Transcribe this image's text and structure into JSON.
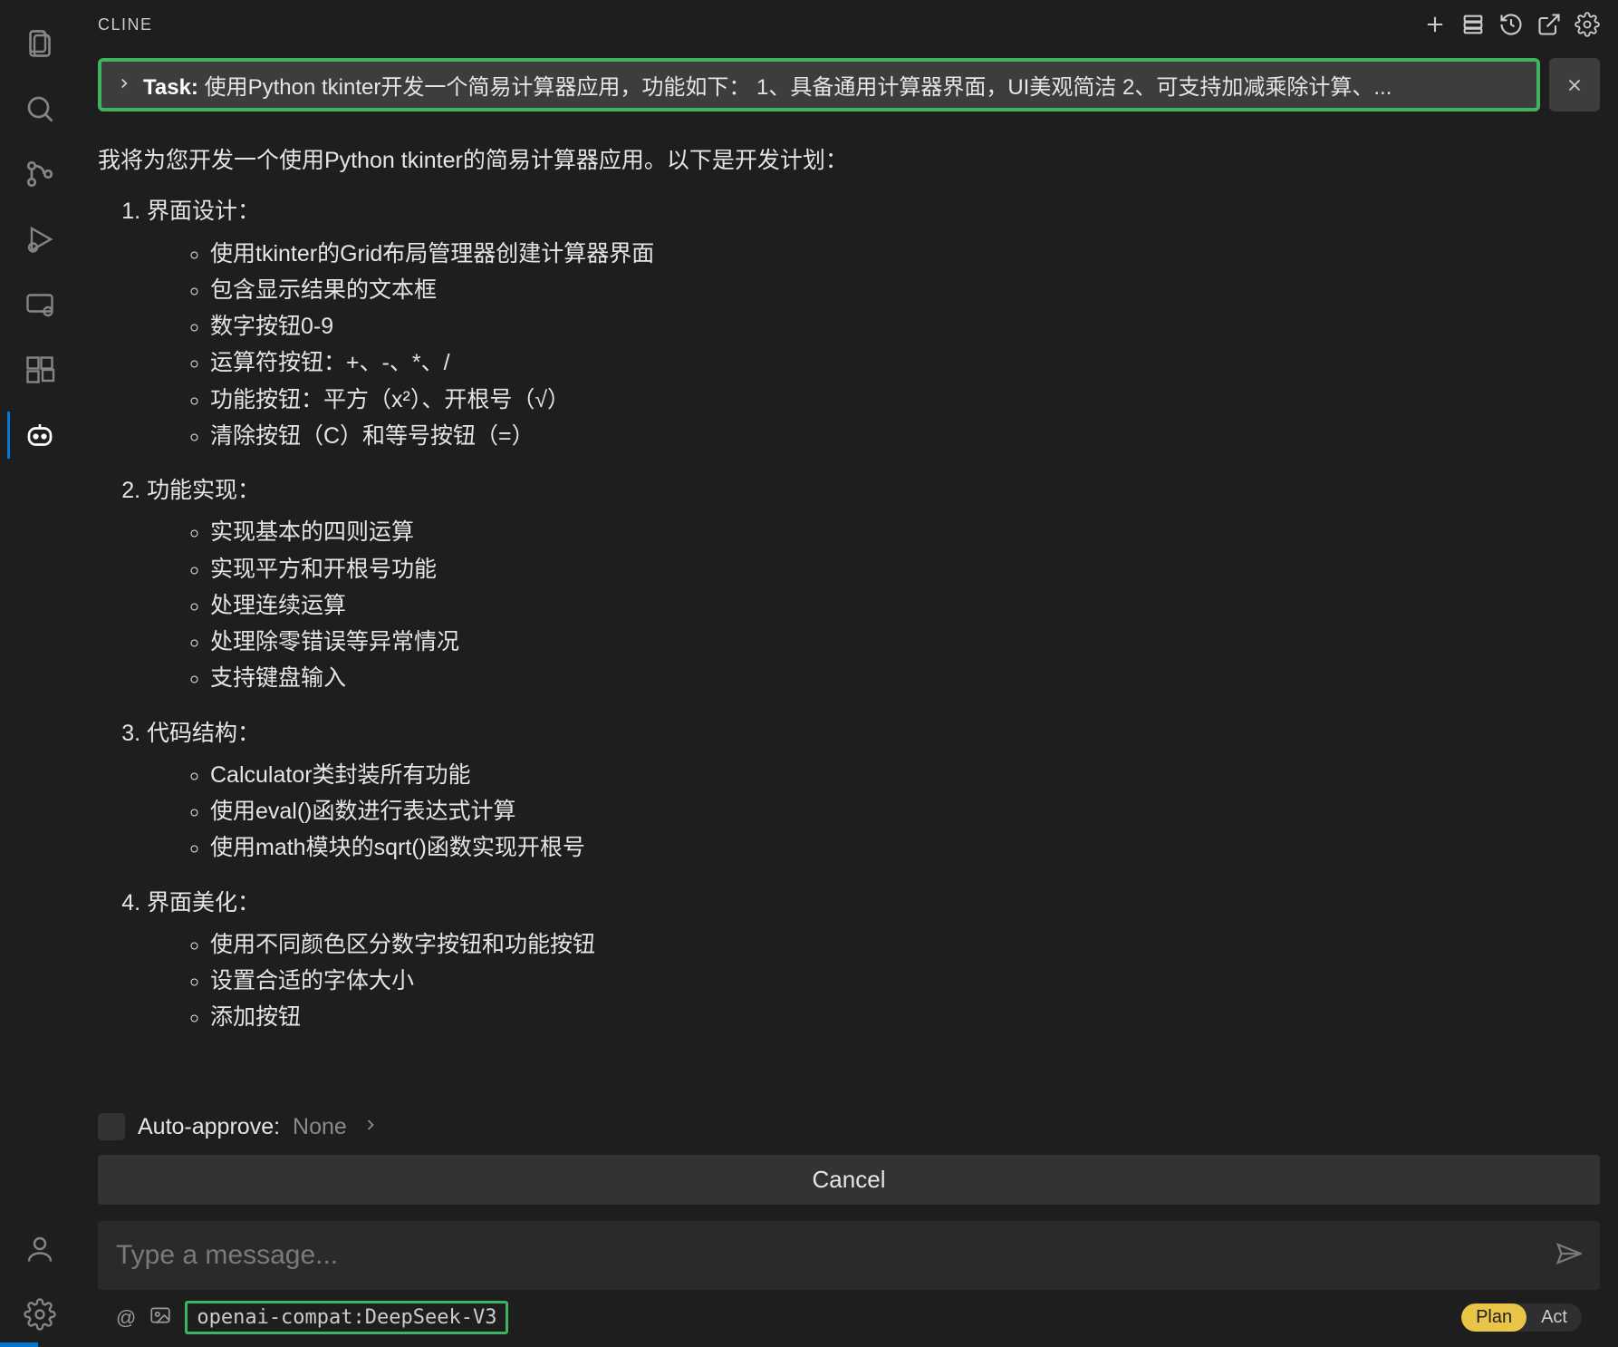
{
  "header": {
    "title": "CLINE"
  },
  "task": {
    "label": "Task:",
    "text": "使用Python tkinter开发一个简易计算器应用，功能如下： 1、具备通用计算器界面，UI美观简洁 2、可支持加减乘除计算、..."
  },
  "message": {
    "intro": "我将为您开发一个使用Python tkinter的简易计算器应用。以下是开发计划：",
    "sections": [
      {
        "title": "界面设计：",
        "items": [
          "使用tkinter的Grid布局管理器创建计算器界面",
          "包含显示结果的文本框",
          "数字按钮0-9",
          "运算符按钮：+、-、*、/",
          "功能按钮：平方（x²）、开根号（√）",
          "清除按钮（C）和等号按钮（=）"
        ]
      },
      {
        "title": "功能实现：",
        "items": [
          "实现基本的四则运算",
          "实现平方和开根号功能",
          "处理连续运算",
          "处理除零错误等异常情况",
          "支持键盘输入"
        ]
      },
      {
        "title": "代码结构：",
        "items": [
          "Calculator类封装所有功能",
          "使用eval()函数进行表达式计算",
          "使用math模块的sqrt()函数实现开根号"
        ]
      },
      {
        "title": "界面美化：",
        "items": [
          "使用不同颜色区分数字按钮和功能按钮",
          "设置合适的字体大小",
          "添加按钮"
        ]
      }
    ]
  },
  "autoApprove": {
    "label": "Auto-approve:",
    "value": "None"
  },
  "buttons": {
    "cancel": "Cancel"
  },
  "input": {
    "placeholder": "Type a message..."
  },
  "footer": {
    "model": "openai-compat:DeepSeek-V3",
    "plan": "Plan",
    "act": "Act"
  }
}
